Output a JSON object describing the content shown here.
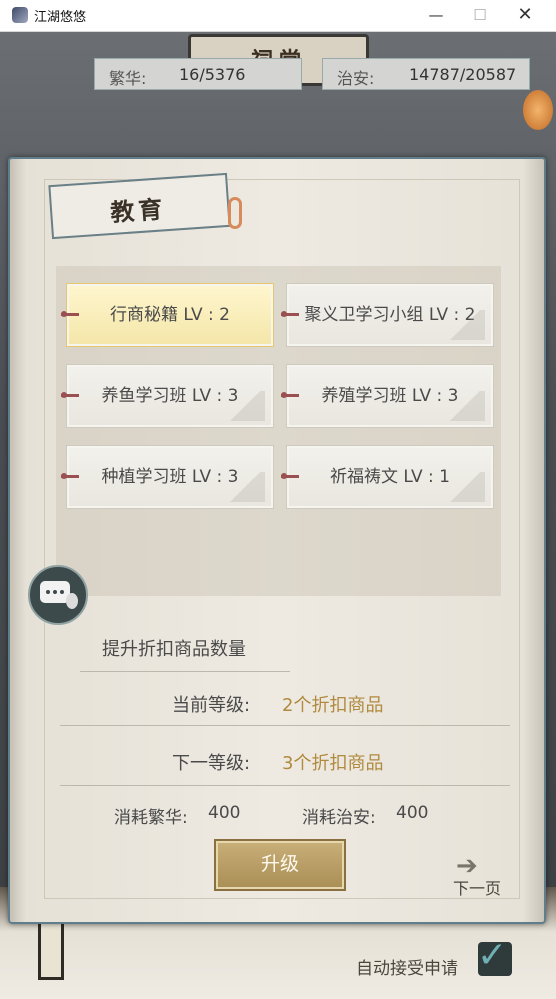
{
  "window": {
    "title": "江湖悠悠",
    "minimize": "—",
    "maximize": "☐",
    "close": "✕"
  },
  "background": {
    "sign_text": "祠堂",
    "stats": {
      "prosperity_label": "繁华:",
      "prosperity_value": "16/5376",
      "security_label": "治安:",
      "security_value": "14787/20587"
    },
    "auto_accept_label": "自动接受申请",
    "auto_accept_checked": true
  },
  "panel": {
    "heading": "教育",
    "skills": [
      {
        "name": "行商秘籍 LV : 2",
        "selected": true
      },
      {
        "name": "聚义卫学习小组 LV : 2",
        "selected": false
      },
      {
        "name": "养鱼学习班 LV : 3",
        "selected": false
      },
      {
        "name": "养殖学习班 LV : 3",
        "selected": false
      },
      {
        "name": "种植学习班 LV : 3",
        "selected": false
      },
      {
        "name": "祈福祷文 LV : 1",
        "selected": false
      }
    ],
    "description": "提升折扣商品数量",
    "current_level_label": "当前等级:",
    "current_level_value": "2个折扣商品",
    "next_level_label": "下一等级:",
    "next_level_value": "3个折扣商品",
    "cost_prosperity_label": "消耗繁华:",
    "cost_prosperity_value": "400",
    "cost_security_label": "消耗治安:",
    "cost_security_value": "400",
    "upgrade_button": "升级",
    "next_page_label": "下一页"
  },
  "colors": {
    "accent_gold": "#b08a3e",
    "selected_bg": "#f4e6a8",
    "button_gold": "#b99c62"
  },
  "icons": {
    "chat": "chat-bubble-gourd-icon",
    "next_page": "arrow-right-icon",
    "checkmark": "checkmark-icon"
  }
}
